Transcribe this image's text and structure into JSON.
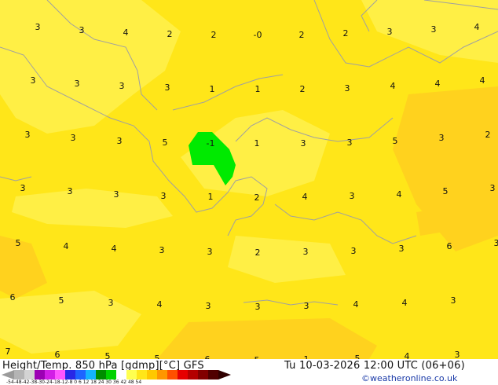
{
  "title": "Height/Temp. 850 hPa [gdmp][°C] GFS",
  "run_info": "Tu 10-03-2026 12:00 UTC (06+06)",
  "credit": "©weatheronline.co.uk",
  "colorbar_ticks": "-54-48-42-38-30-24-18-12-8  0  6  12 18 24 30 36 42 48 54",
  "colors": {
    "bg_yellow": "#ffe619",
    "pale_yellow": "#ffef45",
    "orange_yellow": "#ffd21e",
    "green": "#00ea00",
    "coast": "#a0a0a0"
  },
  "temperature_labels": [
    "3",
    "3",
    "4",
    "2",
    "2",
    "-0",
    "2",
    "2",
    "3",
    "3",
    "4",
    "3",
    "3",
    "3",
    "3",
    "1",
    "1",
    "2",
    "3",
    "4",
    "4",
    "4",
    "3",
    "3",
    "3",
    "5",
    "-1",
    "1",
    "3",
    "3",
    "5",
    "3",
    "2",
    "3",
    "3",
    "3",
    "3",
    "1",
    "2",
    "4",
    "3",
    "4",
    "5",
    "3",
    "5",
    "4",
    "4",
    "3",
    "3",
    "2",
    "3",
    "3",
    "3",
    "6",
    "3",
    "6",
    "5",
    "3",
    "4",
    "3",
    "3",
    "3",
    "4",
    "4",
    "3",
    "7",
    "6",
    "5",
    "5",
    "6",
    "5",
    "1",
    "5",
    "4",
    "3"
  ]
}
